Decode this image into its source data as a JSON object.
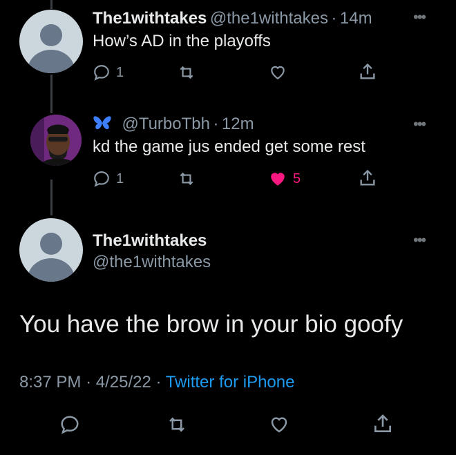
{
  "tweets": [
    {
      "name": "The1withtakes",
      "handle": "@the1withtakes",
      "time": "14m",
      "text": "How’s AD in the playoffs",
      "reply_count": "1",
      "like_count": ""
    },
    {
      "name": "",
      "handle": "@TurboTbh",
      "time": "12m",
      "text": "kd the game jus ended get some rest",
      "reply_count": "1",
      "like_count": "5"
    }
  ],
  "focused": {
    "name": "The1withtakes",
    "handle": "@the1withtakes",
    "text": "You have the brow in your bio goofy",
    "time": "8:37 PM",
    "date": "4/25/22",
    "source": "Twitter for iPhone"
  },
  "separator": "·",
  "colors": {
    "background": "#000000",
    "accent": "#1d9bf0",
    "like": "#f91880",
    "muted": "#8b98a5"
  }
}
